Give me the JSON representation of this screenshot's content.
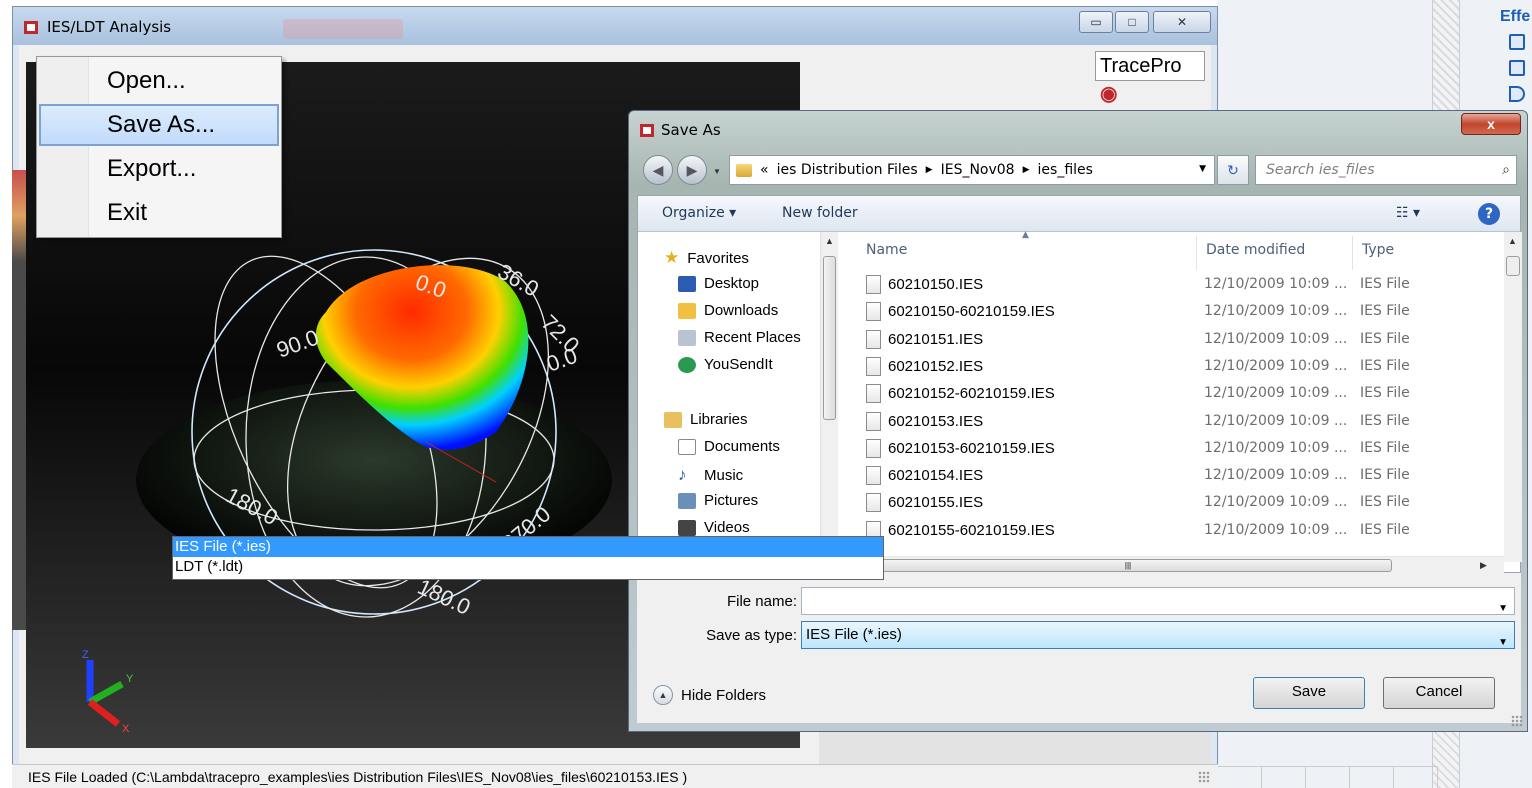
{
  "main_window": {
    "title": "IES/LDT Analysis",
    "minimize": "▭",
    "maximize": "□",
    "close": "✕",
    "logo_text": "TracePro",
    "status_text": "IES File Loaded (C:\\Lambda\\tracepro_examples\\ies Distribution Files\\IES_Nov08\\ies_files\\60210153.IES )"
  },
  "background": {
    "side_header": "Effe"
  },
  "file_menu": {
    "items": [
      {
        "label": "Open...",
        "highlighted": false
      },
      {
        "label": "Save As...",
        "highlighted": true
      },
      {
        "label": "Export...",
        "highlighted": false
      },
      {
        "label": "Exit",
        "highlighted": false
      }
    ]
  },
  "viewport": {
    "sphere_labels": [
      "0.0",
      "36.0",
      "72.0",
      "90.0",
      "0.0",
      "180.0",
      "270.0",
      "180.0"
    ],
    "axes": {
      "x": "X",
      "y": "Y",
      "z": "Z"
    }
  },
  "save_dialog": {
    "title": "Save As",
    "close": "x",
    "breadcrumb_prefix": "«",
    "breadcrumb": [
      "ies Distribution Files",
      "IES_Nov08",
      "ies_files"
    ],
    "search_placeholder": "Search ies_files",
    "toolbar": {
      "organize": "Organize ▾",
      "new_folder": "New folder",
      "help": "?"
    },
    "nav": {
      "favorites_header": "Favorites",
      "favorites": [
        "Desktop",
        "Downloads",
        "Recent Places",
        "YouSendIt"
      ],
      "libraries_header": "Libraries",
      "libraries": [
        "Documents",
        "Music",
        "Pictures",
        "Videos"
      ]
    },
    "columns": {
      "name": "Name",
      "date": "Date modified",
      "type": "Type"
    },
    "files": [
      {
        "name": "60210150.IES",
        "date": "12/10/2009 10:09 ...",
        "type": "IES File"
      },
      {
        "name": "60210150-60210159.IES",
        "date": "12/10/2009 10:09 ...",
        "type": "IES File"
      },
      {
        "name": "60210151.IES",
        "date": "12/10/2009 10:09 ...",
        "type": "IES File"
      },
      {
        "name": "60210152.IES",
        "date": "12/10/2009 10:09 ...",
        "type": "IES File"
      },
      {
        "name": "60210152-60210159.IES",
        "date": "12/10/2009 10:09 ...",
        "type": "IES File"
      },
      {
        "name": "60210153.IES",
        "date": "12/10/2009 10:09 ...",
        "type": "IES File"
      },
      {
        "name": "60210153-60210159.IES",
        "date": "12/10/2009 10:09 ...",
        "type": "IES File"
      },
      {
        "name": "60210154.IES",
        "date": "12/10/2009 10:09 ...",
        "type": "IES File"
      },
      {
        "name": "60210155.IES",
        "date": "12/10/2009 10:09 ...",
        "type": "IES File"
      },
      {
        "name": "60210155-60210159.IES",
        "date": "12/10/2009 10:09 ...",
        "type": "IES File"
      }
    ],
    "file_name_label": "File name:",
    "file_name_value": "",
    "save_type_label": "Save as type:",
    "save_type_value": "IES File (*.ies)",
    "save_type_options": [
      "IES File (*.ies)",
      "LDT (*.ldt)"
    ],
    "hide_folders": "Hide Folders",
    "save_button": "Save",
    "cancel_button": "Cancel"
  }
}
